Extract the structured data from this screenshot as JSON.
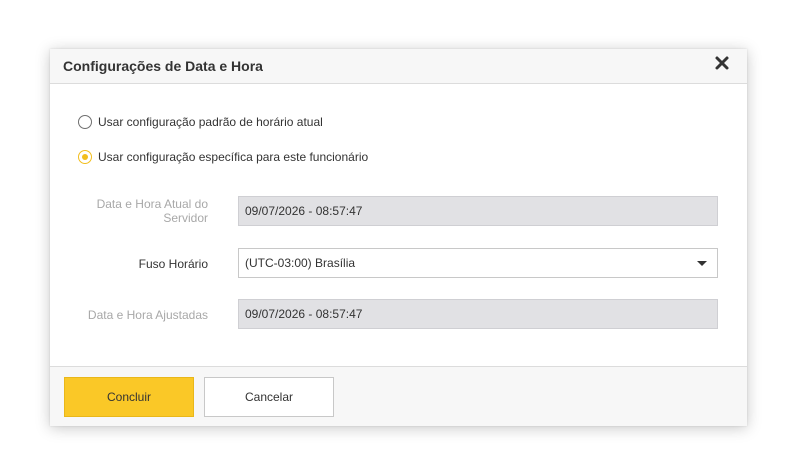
{
  "dialog": {
    "title": "Configurações de Data e Hora",
    "close_icon": "close-x-icon"
  },
  "options": {
    "default_label": "Usar configuração padrão de horário atual",
    "default_checked": false,
    "specific_label": "Usar configuração específica para este funcionário",
    "specific_checked": true
  },
  "fields": {
    "server_datetime_label_line1": "Data e Hora Atual do",
    "server_datetime_label_line2": "Servidor",
    "server_datetime_value": "09/07/2026 - 08:57:47",
    "timezone_label": "Fuso Horário",
    "timezone_value": "(UTC-03:00) Brasília",
    "adjusted_datetime_label": "Data e Hora Ajustadas",
    "adjusted_datetime_value": "09/07/2026 - 08:57:47"
  },
  "footer": {
    "confirm_label": "Concluir",
    "cancel_label": "Cancelar"
  },
  "colors": {
    "accent": "#fac827",
    "radio_checked": "#f2be1d",
    "readonly_bg": "#e1e1e4",
    "header_bg": "#f7f7f7"
  }
}
